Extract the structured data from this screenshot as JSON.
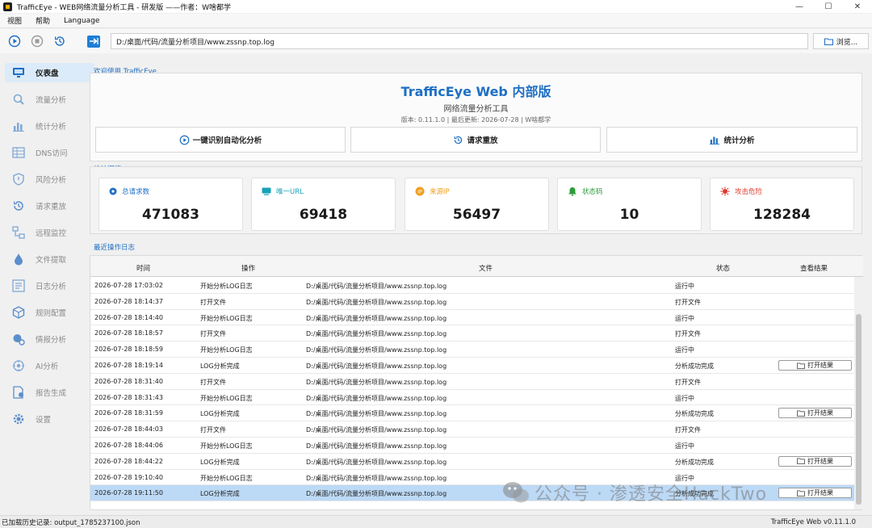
{
  "window": {
    "title": "TrafficEye - WEB网络流量分析工具 - 研发版 ——作者：W啥都学",
    "controls": [
      "—",
      "☐",
      "✕"
    ]
  },
  "menu": [
    "视图",
    "帮助",
    "Language"
  ],
  "toolbar": {
    "path": "D:/桌面/代码/流量分析项目/www.zssnp.top.log",
    "browse_label": "浏览..."
  },
  "sidebar": {
    "items": [
      {
        "label": "仪表盘",
        "icon": "monitor-icon",
        "active": true
      },
      {
        "label": "流量分析",
        "icon": "magnifier-icon",
        "active": false
      },
      {
        "label": "统计分析",
        "icon": "bar-chart-icon",
        "active": false
      },
      {
        "label": "DNS访问",
        "icon": "grid-icon",
        "active": false
      },
      {
        "label": "风险分析",
        "icon": "shield-icon",
        "active": false
      },
      {
        "label": "请求重放",
        "icon": "replay-icon",
        "active": false
      },
      {
        "label": "远程监控",
        "icon": "network-icon",
        "active": false
      },
      {
        "label": "文件提取",
        "icon": "drop-icon",
        "active": false
      },
      {
        "label": "日志分析",
        "icon": "log-icon",
        "active": false
      },
      {
        "label": "规则配置",
        "icon": "cube-icon",
        "active": false
      },
      {
        "label": "情报分析",
        "icon": "intel-icon",
        "active": false
      },
      {
        "label": "AI分析",
        "icon": "ai-icon",
        "active": false
      },
      {
        "label": "报告生成",
        "icon": "report-icon",
        "active": false
      },
      {
        "label": "设置",
        "icon": "gear-icon",
        "active": false
      }
    ]
  },
  "welcome": {
    "section_title": "欢迎使用 TrafficEye",
    "title": "TrafficEye Web 内部版",
    "subtitle": "网络流量分析工具",
    "meta": "版本: 0.11.1.0 | 最后更新: 2026-07-28 | W啥都学",
    "actions": [
      {
        "label": "一键识别自动化分析",
        "icon": "play-icon"
      },
      {
        "label": "请求重放",
        "icon": "replay-icon"
      },
      {
        "label": "统计分析",
        "icon": "bar-chart-icon"
      }
    ]
  },
  "stats": {
    "section_title": "统计概览",
    "cards": [
      {
        "label": "总请求数",
        "value": "471083",
        "color": "#1e6fc4",
        "icon": "circle-icon"
      },
      {
        "label": "唯一URL",
        "value": "69418",
        "color": "#17a2b8",
        "icon": "url-icon"
      },
      {
        "label": "来源IP",
        "value": "56497",
        "color": "#f0a020",
        "icon": "ip-icon"
      },
      {
        "label": "状态码",
        "value": "10",
        "color": "#2e9d3a",
        "icon": "bell-icon"
      },
      {
        "label": "攻击危险",
        "value": "128284",
        "color": "#e0382b",
        "icon": "alert-icon"
      }
    ]
  },
  "log": {
    "section_title": "最近操作日志",
    "headers": [
      "时间",
      "操作",
      "文件",
      "状态",
      "查看结果"
    ],
    "open_label": "打开结果",
    "rows": [
      {
        "time": "2026-07-28 17:03:02",
        "action": "开始分析LOG日志",
        "file": "D:/桌面/代码/流量分析项目/www.zssnp.top.log",
        "status": "运行中",
        "has_result": false
      },
      {
        "time": "2026-07-28 18:14:37",
        "action": "打开文件",
        "file": "D:/桌面/代码/流量分析项目/www.zssnp.top.log",
        "status": "打开文件",
        "has_result": false
      },
      {
        "time": "2026-07-28 18:14:40",
        "action": "开始分析LOG日志",
        "file": "D:/桌面/代码/流量分析项目/www.zssnp.top.log",
        "status": "运行中",
        "has_result": false
      },
      {
        "time": "2026-07-28 18:18:57",
        "action": "打开文件",
        "file": "D:/桌面/代码/流量分析项目/www.zssnp.top.log",
        "status": "打开文件",
        "has_result": false
      },
      {
        "time": "2026-07-28 18:18:59",
        "action": "开始分析LOG日志",
        "file": "D:/桌面/代码/流量分析项目/www.zssnp.top.log",
        "status": "运行中",
        "has_result": false
      },
      {
        "time": "2026-07-28 18:19:14",
        "action": "LOG分析完成",
        "file": "D:/桌面/代码/流量分析项目/www.zssnp.top.log",
        "status": "分析成功完成",
        "has_result": true
      },
      {
        "time": "2026-07-28 18:31:40",
        "action": "打开文件",
        "file": "D:/桌面/代码/流量分析项目/www.zssnp.top.log",
        "status": "打开文件",
        "has_result": false
      },
      {
        "time": "2026-07-28 18:31:43",
        "action": "开始分析LOG日志",
        "file": "D:/桌面/代码/流量分析项目/www.zssnp.top.log",
        "status": "运行中",
        "has_result": false
      },
      {
        "time": "2026-07-28 18:31:59",
        "action": "LOG分析完成",
        "file": "D:/桌面/代码/流量分析项目/www.zssnp.top.log",
        "status": "分析成功完成",
        "has_result": true
      },
      {
        "time": "2026-07-28 18:44:03",
        "action": "打开文件",
        "file": "D:/桌面/代码/流量分析项目/www.zssnp.top.log",
        "status": "打开文件",
        "has_result": false
      },
      {
        "time": "2026-07-28 18:44:06",
        "action": "开始分析LOG日志",
        "file": "D:/桌面/代码/流量分析项目/www.zssnp.top.log",
        "status": "运行中",
        "has_result": false
      },
      {
        "time": "2026-07-28 18:44:22",
        "action": "LOG分析完成",
        "file": "D:/桌面/代码/流量分析项目/www.zssnp.top.log",
        "status": "分析成功完成",
        "has_result": true
      },
      {
        "time": "2026-07-28 19:10:40",
        "action": "开始分析LOG日志",
        "file": "D:/桌面/代码/流量分析项目/www.zssnp.top.log",
        "status": "运行中",
        "has_result": false
      },
      {
        "time": "2026-07-28 19:11:50",
        "action": "LOG分析完成",
        "file": "D:/桌面/代码/流量分析项目/www.zssnp.top.log",
        "status": "分析成功完成",
        "has_result": true,
        "selected": true
      }
    ]
  },
  "watermark": "公众号 · 渗透安全HackTwo",
  "status": {
    "left": "已加载历史记录: output_1785237100.json",
    "right": "TrafficEye Web v0.11.1.0"
  }
}
